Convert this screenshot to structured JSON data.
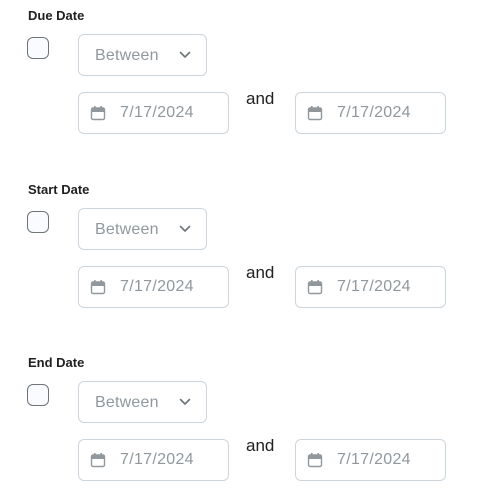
{
  "sections": [
    {
      "title": "Due Date",
      "range_type": "Between",
      "from_date": "7/17/2024",
      "connector": "and",
      "to_date": "7/17/2024"
    },
    {
      "title": "Start Date",
      "range_type": "Between",
      "from_date": "7/17/2024",
      "connector": "and",
      "to_date": "7/17/2024"
    },
    {
      "title": "End Date",
      "range_type": "Between",
      "from_date": "7/17/2024",
      "connector": "and",
      "to_date": "7/17/2024"
    }
  ],
  "icons": {
    "date": "calendar-icon",
    "select": "chevron-down-icon"
  },
  "colors": {
    "disabled_text": "#90989d",
    "border": "#cdd5dc",
    "checkbox_border": "#6e7477"
  }
}
